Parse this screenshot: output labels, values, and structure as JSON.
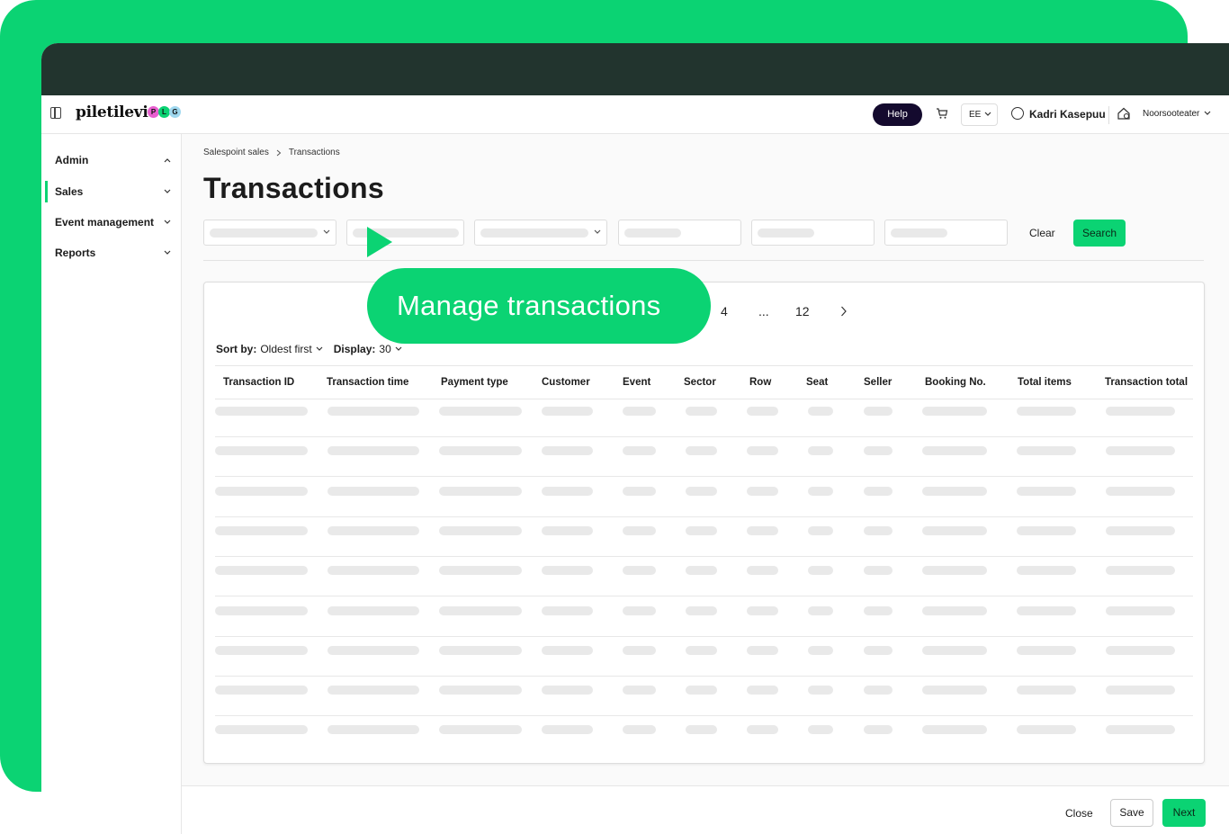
{
  "header": {
    "logo": "piletilevi",
    "badges": [
      "P",
      "L",
      "G"
    ],
    "help_label": "Help",
    "language": "EE",
    "user_name": "Kadri Kasepuu",
    "venue": "Noorsooteater"
  },
  "sidebar": {
    "items": [
      {
        "label": "Admin",
        "expanded": true
      },
      {
        "label": "Sales",
        "active": true
      },
      {
        "label": "Event management"
      },
      {
        "label": "Reports"
      }
    ]
  },
  "breadcrumb": {
    "parent": "Salespoint sales",
    "current": "Transactions"
  },
  "page_title": "Transactions",
  "filters": {
    "clear_label": "Clear",
    "search_label": "Search"
  },
  "pagination": {
    "page_4": "4",
    "ellipsis": "...",
    "last_page": "12"
  },
  "sort": {
    "sort_label": "Sort by:",
    "sort_value": "Oldest first",
    "display_label": "Display:",
    "display_value": "30"
  },
  "table": {
    "columns": [
      "Transaction ID",
      "Transaction time",
      "Payment type",
      "Customer",
      "Event",
      "Sector",
      "Row",
      "Seat",
      "Seller",
      "Booking No.",
      "Total items",
      "Transaction total"
    ],
    "placeholder_row_count": 9
  },
  "callout": {
    "text": "Manage transactions"
  },
  "footer": {
    "close_label": "Close",
    "save_label": "Save",
    "next_label": "Next"
  },
  "colors": {
    "accent": "#0bd373",
    "dark": "#22342e",
    "help_bg": "#140a2e"
  },
  "icons": [
    "sidebar-toggle-icon",
    "cart-icon",
    "user-icon",
    "venue-icon",
    "chevron-down-icon",
    "chevron-right-icon",
    "play-icon"
  ]
}
